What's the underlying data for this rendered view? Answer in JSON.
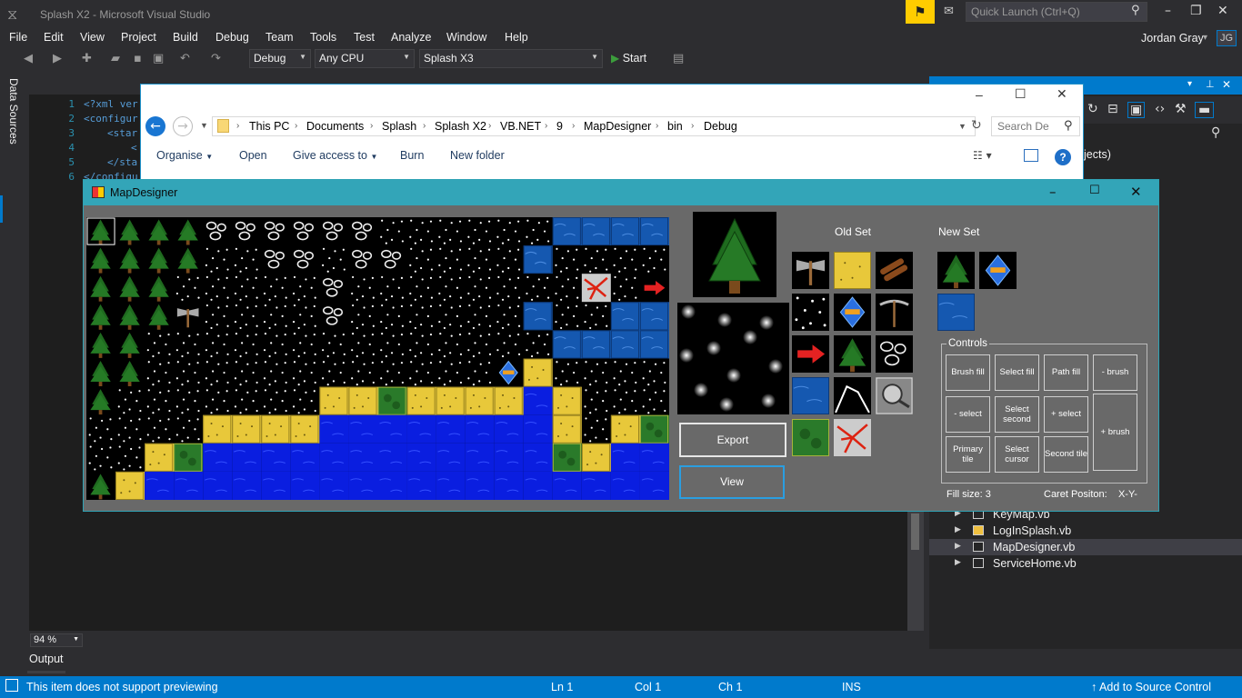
{
  "vs": {
    "window_title": "Splash X2 - Microsoft Visual Studio",
    "quick_launch_placeholder": "Quick Launch (Ctrl+Q)",
    "menu": [
      "File",
      "Edit",
      "View",
      "Project",
      "Build",
      "Debug",
      "Team",
      "Tools",
      "Test",
      "Analyze",
      "Window",
      "Help"
    ],
    "user_name": "Jordan Gray",
    "user_initials": "JG",
    "toolbar": {
      "config": "Debug",
      "platform": "Any CPU",
      "startup_project": "Splash X3",
      "start_label": "Start"
    },
    "data_sources_label": "Data Sources",
    "editor": {
      "line_numbers": [
        "1",
        "2",
        "3",
        "4",
        "5",
        "6"
      ],
      "lines": [
        "<?xml ver",
        "<configur",
        "<star",
        "<",
        "</sta",
        "</configu"
      ],
      "zoom": "94 %"
    },
    "output_tab": "Output",
    "solution_explorer": {
      "partial_text": "jects)",
      "items": [
        {
          "label": "KeyMap.vb"
        },
        {
          "label": "LogInSplash.vb"
        },
        {
          "label": "MapDesigner.vb"
        },
        {
          "label": "ServiceHome.vb"
        }
      ]
    },
    "status": {
      "message": "This item does not support previewing",
      "ln": "Ln 1",
      "col": "Col 1",
      "ch": "Ch 1",
      "mode": "INS",
      "source_control": "Add to Source Control"
    }
  },
  "explorer": {
    "breadcrumb": [
      "This PC",
      "Documents",
      "Splash",
      "Splash X2",
      "VB.NET",
      "9",
      "MapDesigner",
      "bin",
      "Debug"
    ],
    "search_placeholder": "Search De",
    "commands": {
      "organise": "Organise",
      "open": "Open",
      "give_access": "Give access to",
      "burn": "Burn",
      "new_folder": "New folder"
    }
  },
  "map_designer": {
    "title": "MapDesigner",
    "export_label": "Export",
    "view_label": "View",
    "old_set_label": "Old Set",
    "new_set_label": "New Set",
    "controls_label": "Controls",
    "controls": {
      "brush_fill": "Brush fill",
      "select_fill": "Select fill",
      "path_fill": "Path fill",
      "minus_brush": "- brush",
      "minus_select": "- select",
      "select_second": "Select second",
      "plus_select": "+ select",
      "plus_brush": "+ brush",
      "primary_tile": "Primary tile",
      "select_cursor": "Select cursor",
      "second_tile": "Second tile"
    },
    "fill_size": "Fill size: 3",
    "caret_position": "Caret Positon:",
    "caret_value": "X-Y-",
    "tile_grid_rows": [
      "TTTTRRRRRRSSSSSSwwww",
      "TTTTSSRRSRRSSSSwSSSS",
      "TTTSSSSSRSSSSSSSSLSA",
      "TTTXSSSSRSSSSSSwSSww",
      "TTSSSSSSSSSSSSSSwwww",
      "TTSSSSSSSSSSSSDYSSSS",
      "TSSSSSSSYYGYYYYbYSSS",
      "SSSSYYYYbbbbbbbbYSYG",
      "SSYGbbbbbbbbbbbbGYbb",
      "TYbbbbbbbbbbbbbbbbbb"
    ],
    "old_set_tiles": [
      "axe",
      "sand",
      "logs",
      "stars",
      "ship",
      "pickaxe",
      "arrow",
      "tree",
      "rock",
      "water",
      "boulder",
      "magnifier",
      "bush",
      "lava"
    ],
    "new_set_tiles": [
      "tree",
      "ship",
      "water"
    ]
  }
}
